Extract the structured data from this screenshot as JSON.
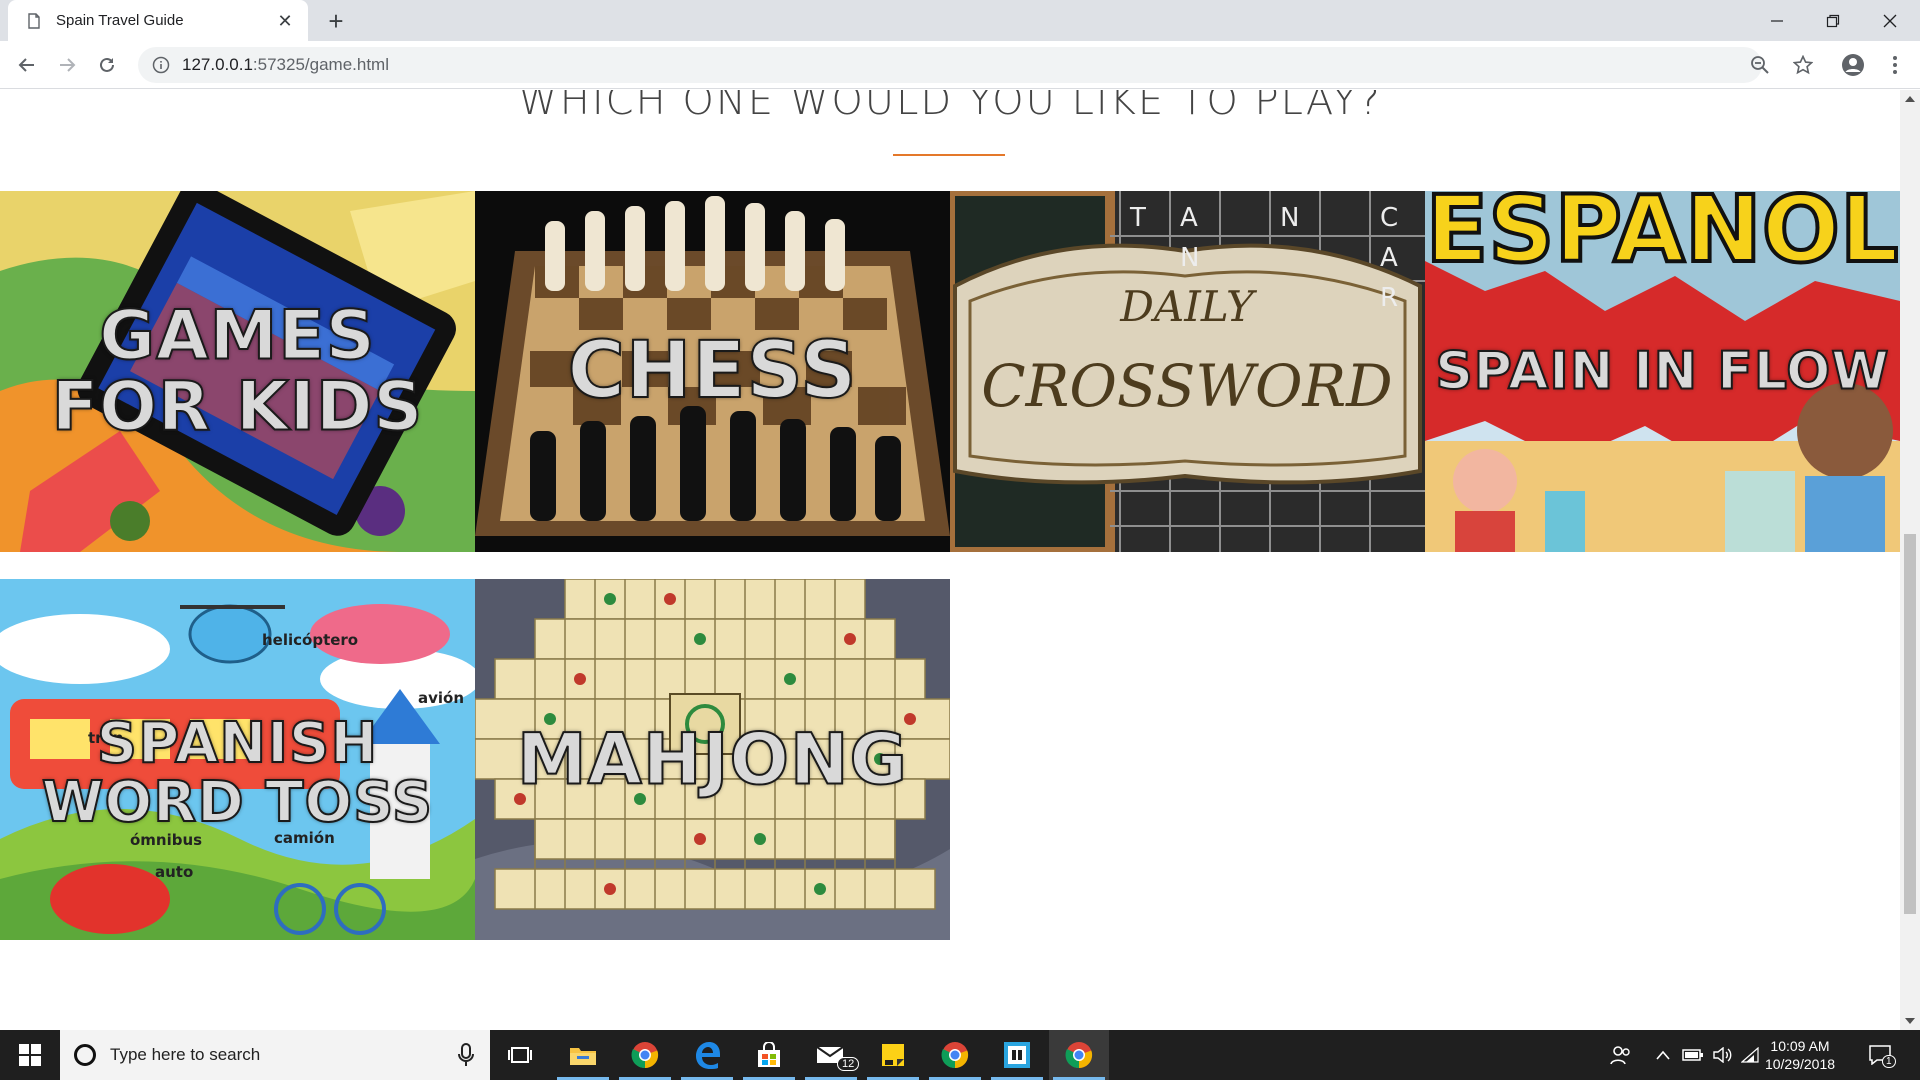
{
  "browser": {
    "tab_title": "Spain Travel Guide",
    "url_host": "127.0.0.1",
    "url_rest": ":57325/game.html",
    "colors": {
      "tabstrip": "#dee1e6",
      "omnibox": "#f1f3f4"
    }
  },
  "page": {
    "heading": "WHICH ONE WOULD YOU LIKE TO PLAY?",
    "accent_color": "#e4782a",
    "games": [
      {
        "label_line1": "GAMES",
        "label_line2": "FOR KIDS"
      },
      {
        "label_line1": "CHESS",
        "label_line2": ""
      },
      {
        "art_title_top": "DAILY",
        "art_title_bottom": "CROSSWORD",
        "art_letters": [
          "T",
          "A",
          "N",
          "C",
          "A",
          "R",
          "N"
        ]
      },
      {
        "art_banner": "ESPAÑOL",
        "label_line1": "SPAIN IN FLOW",
        "label_line2": ""
      },
      {
        "label_line1": "SPANISH",
        "label_line2": "WORD TOSS",
        "art_words": [
          "helicóptero",
          "avión",
          "tren",
          "ómnibus",
          "camión",
          "auto"
        ]
      },
      {
        "label_line1": "MAHJONG",
        "label_line2": ""
      }
    ]
  },
  "taskbar": {
    "search_placeholder": "Type here to search",
    "mail_badge": "12",
    "time": "10:09 AM",
    "date": "10/29/2018",
    "notifications_count": "1",
    "pinned_icons": [
      "task-view-icon",
      "file-explorer-icon",
      "chrome-icon",
      "edge-icon",
      "store-icon",
      "mail-icon",
      "sticky-notes-icon",
      "chrome-icon",
      "app-icon",
      "chrome-icon"
    ]
  }
}
